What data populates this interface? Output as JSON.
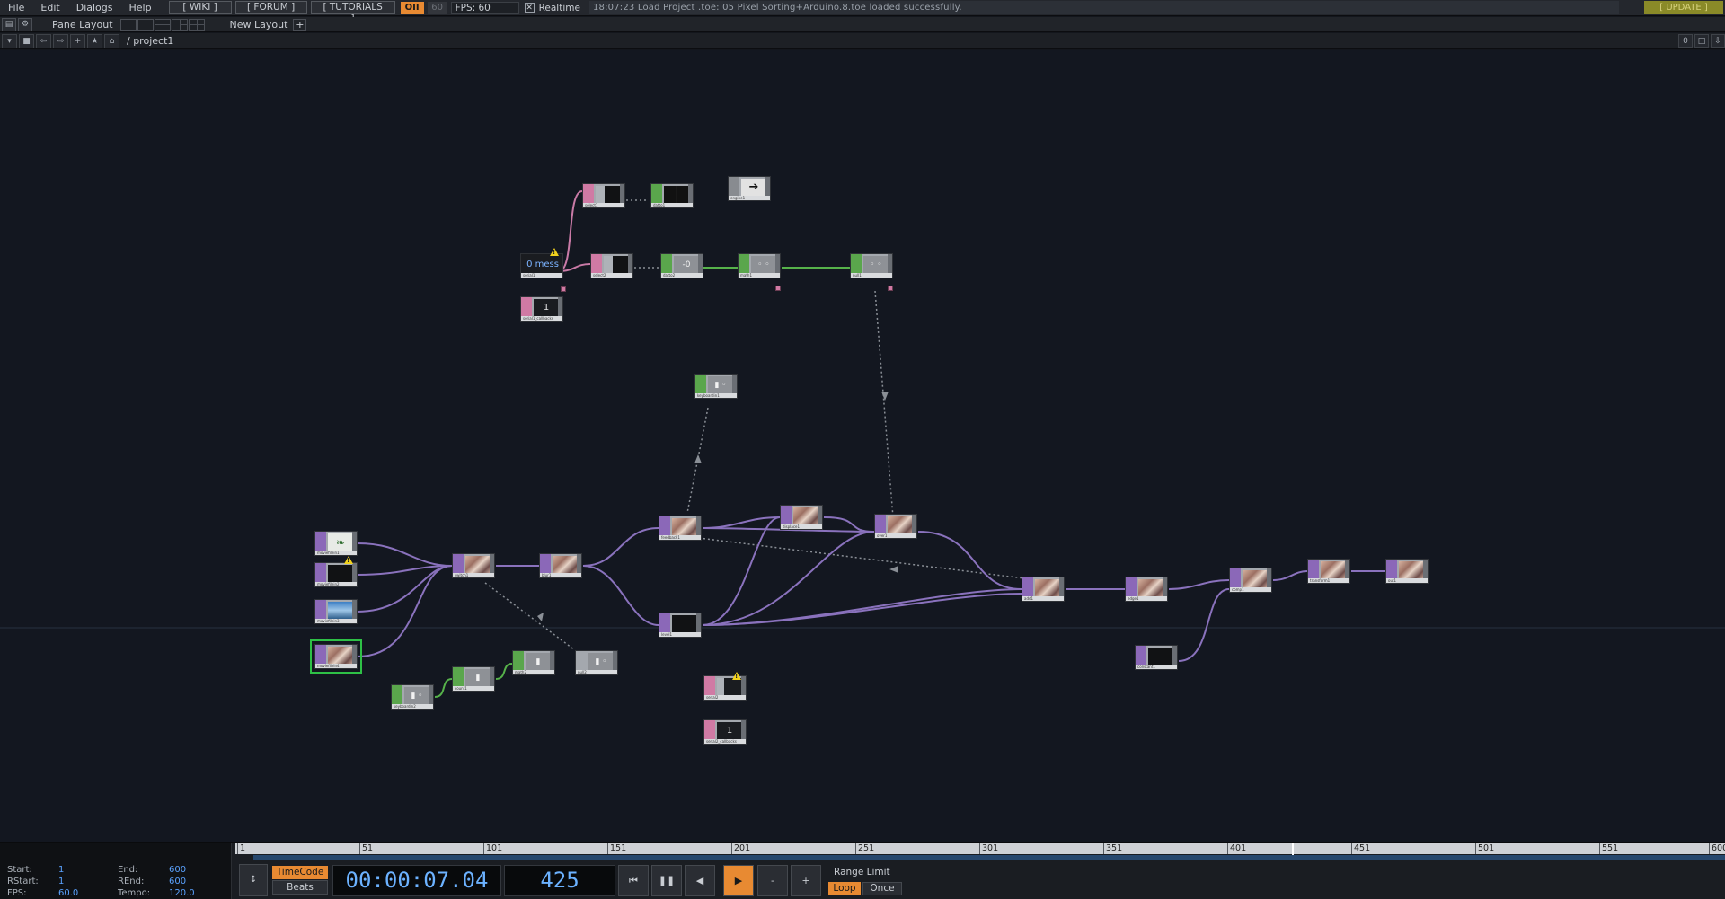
{
  "menubar": {
    "items": [
      "File",
      "Edit",
      "Dialogs",
      "Help"
    ],
    "wiki": "[ WIKI ]",
    "forum": "[ FORUM ]",
    "tutorials": "[ TUTORIALS ]",
    "op_badge": "OII",
    "fps_badge": "60",
    "fps_label": "FPS:  60",
    "realtime_label": "Realtime",
    "status": "18:07:23 Load Project .toe: 05 Pixel Sorting+Arduino.8.toe loaded successfully.",
    "update": "[ UPDATE ]"
  },
  "panebar": {
    "pane_layout_label": "Pane Layout",
    "new_layout_label": "New Layout",
    "plus": "+"
  },
  "pathbar": {
    "path": "/ project1",
    "right_value": "0"
  },
  "network": {
    "serial_text": "0 mess",
    "serial_count_text": "1",
    "serial2_count_text": "1",
    "constant_text": "1",
    "node_labels": {
      "select1": "select1",
      "datto1": "datto1",
      "engine1": "engine1",
      "serial1": "serial1",
      "select2": "select2",
      "datto2": "datto2",
      "math1": "math1",
      "null1": "null1",
      "serial1_callbacks": "serial1_callbacks",
      "keyboardin1": "keyboardin1",
      "moviefilein1": "moviefilein1",
      "moviefilein2": "moviefilein2",
      "moviefilein3": "moviefilein3",
      "moviefilein4": "moviefilein4",
      "switch1": "switch1",
      "blur1": "blur1",
      "feedback1": "feedback1",
      "level1": "level1",
      "displace1": "displace1",
      "over1": "over1",
      "keyboardin2": "keyboardin2",
      "count1": "count1",
      "math2": "math2",
      "null2": "null2",
      "serial2": "serial2",
      "serial2_callbacks": "serial2_callbacks",
      "add1": "add1",
      "edge1": "edge1",
      "comp1": "comp1",
      "transform1": "transform1",
      "out1": "out1",
      "constant1": "constant1"
    }
  },
  "timeline": {
    "start_label": "Start:",
    "start_value": "1",
    "end_label": "End:",
    "end_value": "600",
    "rstart_label": "RStart:",
    "rstart_value": "1",
    "rend_label": "REnd:",
    "rend_value": "600",
    "fps_label": "FPS:",
    "fps_value": "60.0",
    "tempo_label": "Tempo:",
    "tempo_value": "120.0",
    "ruler_ticks": [
      "1",
      "51",
      "101",
      "151",
      "201",
      "251",
      "301",
      "351",
      "401",
      "451",
      "501",
      "551",
      "600"
    ],
    "current_frame": 425,
    "timecode_label": "TimeCode",
    "beats_label": "Beats",
    "timecode_value": "00:00:07.04",
    "frame_value": "425",
    "range_limit_label": "Range Limit",
    "loop_label": "Loop",
    "once_label": "Once",
    "transport": {
      "rewind": "⏮",
      "pause": "❚❚",
      "step_back": "◀",
      "play": "▶",
      "minus": "-",
      "plus": "+"
    },
    "colors": {
      "accent": "#e88a32",
      "display_text": "#6cb2ff"
    }
  }
}
